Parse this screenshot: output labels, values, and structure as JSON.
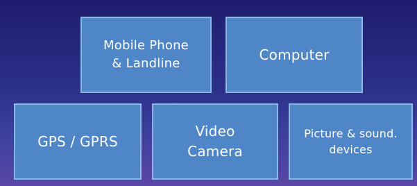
{
  "diagram": {
    "boxes": [
      {
        "id": "mobile-phone-landline",
        "label": "Mobile Phone\n& Landline"
      },
      {
        "id": "computer",
        "label": "Computer"
      },
      {
        "id": "gps-gprs",
        "label": "GPS / GPRS"
      },
      {
        "id": "video-camera",
        "label": "Video\nCamera"
      },
      {
        "id": "picture-sound-devices",
        "label": "Picture & sound.\ndevices"
      }
    ]
  },
  "colors": {
    "background_top": "#1f1c6e",
    "background_bottom": "#5b46a6",
    "box_fill": "#4f86c8",
    "box_border": "#8fb7e6",
    "text": "#ffffff"
  }
}
